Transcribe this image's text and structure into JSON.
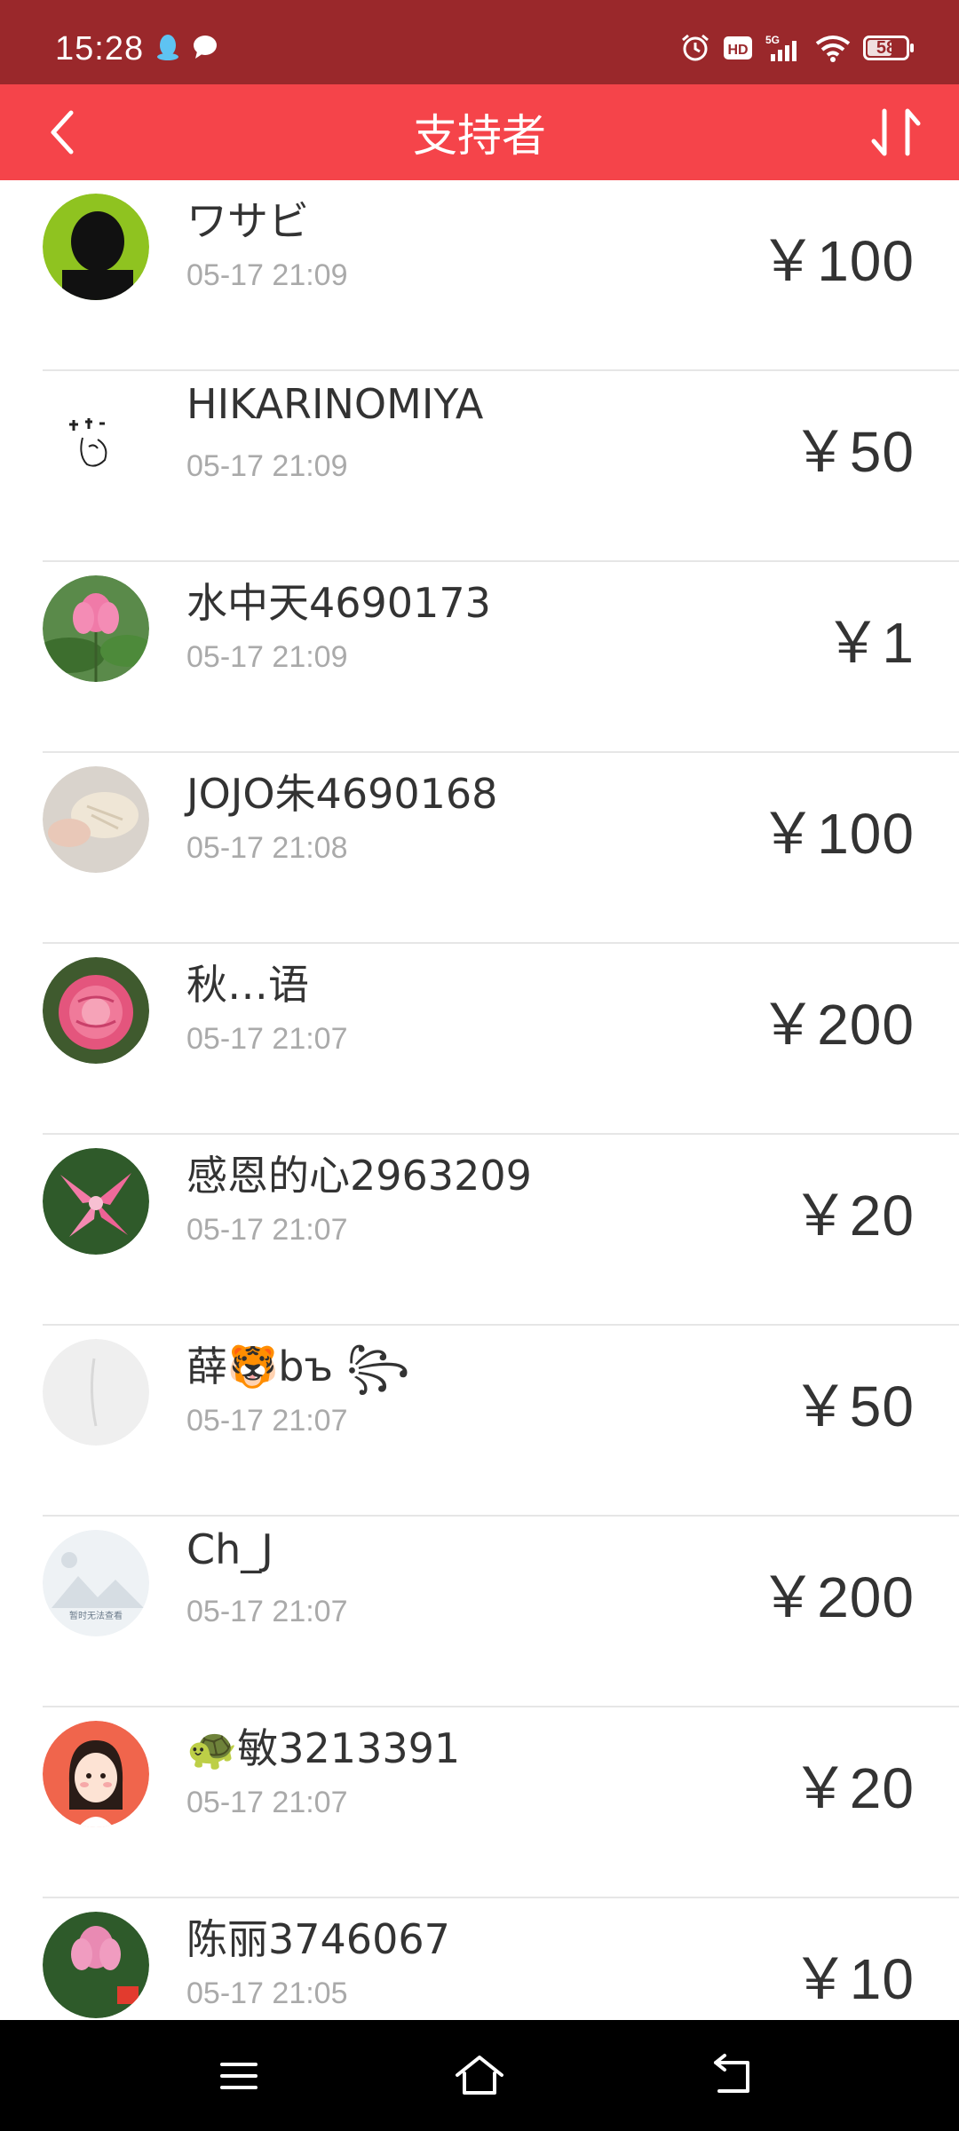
{
  "status_bar": {
    "time": "15:28",
    "battery": "58",
    "icons": [
      "qq-penguin-icon",
      "chat-bubble-icon",
      "alarm-icon",
      "hd-icon",
      "signal-5g-icon",
      "wifi-icon",
      "battery-icon"
    ]
  },
  "header": {
    "title": "支持者",
    "back_icon": "chevron-left-icon",
    "sort_icon": "sort-arrows-icon"
  },
  "supporters": [
    {
      "name": "ワサビ",
      "time": "05-17 21:09",
      "amount": "￥100"
    },
    {
      "name": "HIKARINOMIYA",
      "time": "05-17 21:09",
      "amount": "￥50"
    },
    {
      "name": "水中天4690173",
      "time": "05-17 21:09",
      "amount": "￥1"
    },
    {
      "name": "JOJO朱4690168",
      "time": "05-17 21:08",
      "amount": "￥100"
    },
    {
      "name": "秋…语",
      "time": "05-17 21:07",
      "amount": "￥200"
    },
    {
      "name": "感恩的心2963209",
      "time": "05-17 21:07",
      "amount": "￥20"
    },
    {
      "name": "薛🐯bъ ꧂",
      "time": "05-17 21:07",
      "amount": "￥50"
    },
    {
      "name": "Ch_J",
      "time": "05-17 21:07",
      "amount": "￥200"
    },
    {
      "name": "🐢敏3213391",
      "time": "05-17 21:07",
      "amount": "￥20"
    },
    {
      "name": "陈丽3746067",
      "time": "05-17 21:05",
      "amount": "￥10"
    }
  ],
  "avatar_placeholder_text": "暂时无法查看",
  "nav_bar": {
    "icons": [
      "menu-icon",
      "home-icon",
      "back-icon"
    ]
  }
}
